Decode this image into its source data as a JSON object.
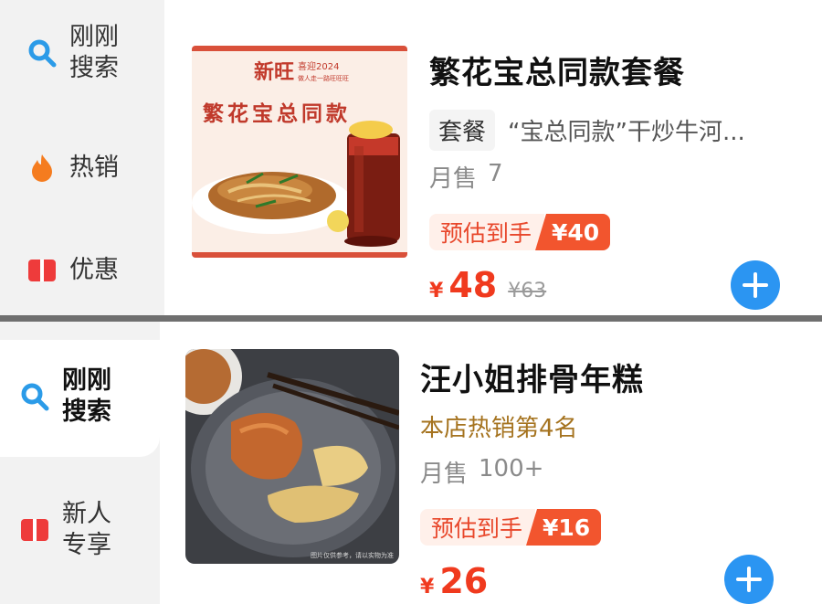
{
  "listing1": {
    "sidebar": [
      {
        "icon": "search-icon",
        "label": "刚刚\n搜索"
      },
      {
        "icon": "fire-icon",
        "label": "热销"
      },
      {
        "icon": "coupon-icon",
        "label": "优惠"
      }
    ],
    "product": {
      "image_text": {
        "brand": "新旺",
        "badge": "喜迎2024",
        "slogan": "做人走一路旺旺旺",
        "headline": "繁花宝总同款"
      },
      "title": "繁花宝总同款套餐",
      "tag": "套餐",
      "description": "“宝总同款”干炒牛河...",
      "sales_label": "月售",
      "sales_value": "7",
      "estimate_label": "预估到手",
      "estimate_amount": "¥40",
      "price_currency": "¥",
      "price": "48",
      "original_price": "¥63"
    }
  },
  "listing2": {
    "sidebar": [
      {
        "icon": "search-icon",
        "label": "刚刚\n搜索"
      },
      {
        "icon": "coupon-icon",
        "label": "新人\n专享"
      }
    ],
    "product": {
      "image_caption": "图片仅供参考，请以实物为准",
      "title": "汪小姐排骨年糕",
      "rank": "本店热销第4名",
      "sales_label": "月售",
      "sales_value": "100+",
      "estimate_label": "预估到手",
      "estimate_amount": "¥16",
      "price_currency": "¥",
      "price": "26"
    }
  },
  "colors": {
    "accent_blue": "#2b95f2",
    "price_red": "#f03a1e",
    "estimate_orange": "#f2552e",
    "rank_gold": "#a5731f"
  }
}
